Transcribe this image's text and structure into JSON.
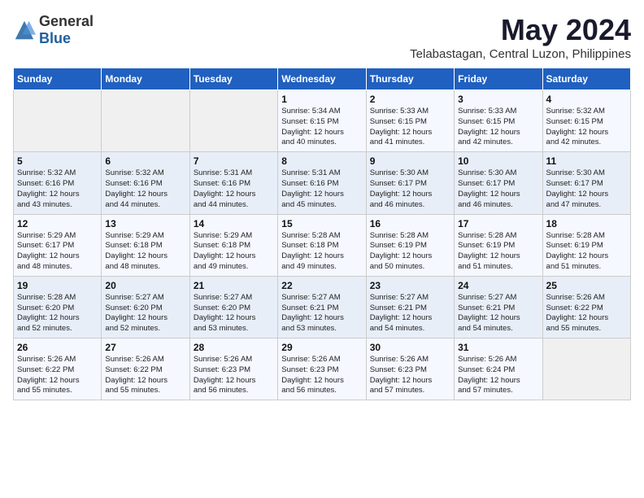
{
  "header": {
    "logo_general": "General",
    "logo_blue": "Blue",
    "title": "May 2024",
    "location": "Telabastagan, Central Luzon, Philippines"
  },
  "weekdays": [
    "Sunday",
    "Monday",
    "Tuesday",
    "Wednesday",
    "Thursday",
    "Friday",
    "Saturday"
  ],
  "weeks": [
    [
      {
        "day": "",
        "info": ""
      },
      {
        "day": "",
        "info": ""
      },
      {
        "day": "",
        "info": ""
      },
      {
        "day": "1",
        "info": "Sunrise: 5:34 AM\nSunset: 6:15 PM\nDaylight: 12 hours\nand 40 minutes."
      },
      {
        "day": "2",
        "info": "Sunrise: 5:33 AM\nSunset: 6:15 PM\nDaylight: 12 hours\nand 41 minutes."
      },
      {
        "day": "3",
        "info": "Sunrise: 5:33 AM\nSunset: 6:15 PM\nDaylight: 12 hours\nand 42 minutes."
      },
      {
        "day": "4",
        "info": "Sunrise: 5:32 AM\nSunset: 6:15 PM\nDaylight: 12 hours\nand 42 minutes."
      }
    ],
    [
      {
        "day": "5",
        "info": "Sunrise: 5:32 AM\nSunset: 6:16 PM\nDaylight: 12 hours\nand 43 minutes."
      },
      {
        "day": "6",
        "info": "Sunrise: 5:32 AM\nSunset: 6:16 PM\nDaylight: 12 hours\nand 44 minutes."
      },
      {
        "day": "7",
        "info": "Sunrise: 5:31 AM\nSunset: 6:16 PM\nDaylight: 12 hours\nand 44 minutes."
      },
      {
        "day": "8",
        "info": "Sunrise: 5:31 AM\nSunset: 6:16 PM\nDaylight: 12 hours\nand 45 minutes."
      },
      {
        "day": "9",
        "info": "Sunrise: 5:30 AM\nSunset: 6:17 PM\nDaylight: 12 hours\nand 46 minutes."
      },
      {
        "day": "10",
        "info": "Sunrise: 5:30 AM\nSunset: 6:17 PM\nDaylight: 12 hours\nand 46 minutes."
      },
      {
        "day": "11",
        "info": "Sunrise: 5:30 AM\nSunset: 6:17 PM\nDaylight: 12 hours\nand 47 minutes."
      }
    ],
    [
      {
        "day": "12",
        "info": "Sunrise: 5:29 AM\nSunset: 6:17 PM\nDaylight: 12 hours\nand 48 minutes."
      },
      {
        "day": "13",
        "info": "Sunrise: 5:29 AM\nSunset: 6:18 PM\nDaylight: 12 hours\nand 48 minutes."
      },
      {
        "day": "14",
        "info": "Sunrise: 5:29 AM\nSunset: 6:18 PM\nDaylight: 12 hours\nand 49 minutes."
      },
      {
        "day": "15",
        "info": "Sunrise: 5:28 AM\nSunset: 6:18 PM\nDaylight: 12 hours\nand 49 minutes."
      },
      {
        "day": "16",
        "info": "Sunrise: 5:28 AM\nSunset: 6:19 PM\nDaylight: 12 hours\nand 50 minutes."
      },
      {
        "day": "17",
        "info": "Sunrise: 5:28 AM\nSunset: 6:19 PM\nDaylight: 12 hours\nand 51 minutes."
      },
      {
        "day": "18",
        "info": "Sunrise: 5:28 AM\nSunset: 6:19 PM\nDaylight: 12 hours\nand 51 minutes."
      }
    ],
    [
      {
        "day": "19",
        "info": "Sunrise: 5:28 AM\nSunset: 6:20 PM\nDaylight: 12 hours\nand 52 minutes."
      },
      {
        "day": "20",
        "info": "Sunrise: 5:27 AM\nSunset: 6:20 PM\nDaylight: 12 hours\nand 52 minutes."
      },
      {
        "day": "21",
        "info": "Sunrise: 5:27 AM\nSunset: 6:20 PM\nDaylight: 12 hours\nand 53 minutes."
      },
      {
        "day": "22",
        "info": "Sunrise: 5:27 AM\nSunset: 6:21 PM\nDaylight: 12 hours\nand 53 minutes."
      },
      {
        "day": "23",
        "info": "Sunrise: 5:27 AM\nSunset: 6:21 PM\nDaylight: 12 hours\nand 54 minutes."
      },
      {
        "day": "24",
        "info": "Sunrise: 5:27 AM\nSunset: 6:21 PM\nDaylight: 12 hours\nand 54 minutes."
      },
      {
        "day": "25",
        "info": "Sunrise: 5:26 AM\nSunset: 6:22 PM\nDaylight: 12 hours\nand 55 minutes."
      }
    ],
    [
      {
        "day": "26",
        "info": "Sunrise: 5:26 AM\nSunset: 6:22 PM\nDaylight: 12 hours\nand 55 minutes."
      },
      {
        "day": "27",
        "info": "Sunrise: 5:26 AM\nSunset: 6:22 PM\nDaylight: 12 hours\nand 55 minutes."
      },
      {
        "day": "28",
        "info": "Sunrise: 5:26 AM\nSunset: 6:23 PM\nDaylight: 12 hours\nand 56 minutes."
      },
      {
        "day": "29",
        "info": "Sunrise: 5:26 AM\nSunset: 6:23 PM\nDaylight: 12 hours\nand 56 minutes."
      },
      {
        "day": "30",
        "info": "Sunrise: 5:26 AM\nSunset: 6:23 PM\nDaylight: 12 hours\nand 57 minutes."
      },
      {
        "day": "31",
        "info": "Sunrise: 5:26 AM\nSunset: 6:24 PM\nDaylight: 12 hours\nand 57 minutes."
      },
      {
        "day": "",
        "info": ""
      }
    ]
  ]
}
